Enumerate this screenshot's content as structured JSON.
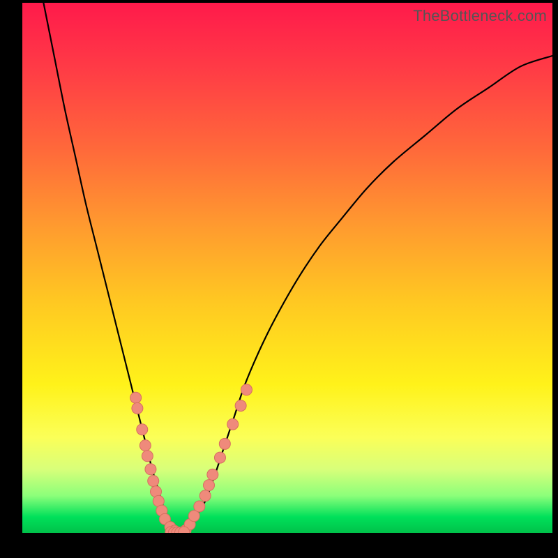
{
  "watermark": "TheBottleneck.com",
  "colors": {
    "curve": "#000000",
    "marker_fill": "#ef8a7b",
    "marker_stroke": "#d66e60",
    "background_top": "#ff1a4b",
    "background_bottom": "#00c24a"
  },
  "chart_data": {
    "type": "line",
    "title": "",
    "xlabel": "",
    "ylabel": "",
    "xlim": [
      0,
      100
    ],
    "ylim": [
      0,
      100
    ],
    "grid": false,
    "series": [
      {
        "name": "bottleneck_curve",
        "x": [
          4,
          6,
          8,
          10,
          12,
          14,
          16,
          18,
          20,
          21.5,
          23,
          24.5,
          26,
          27,
          28,
          29,
          30,
          31,
          34,
          36,
          38,
          40,
          42,
          45,
          48,
          52,
          56,
          60,
          65,
          70,
          76,
          82,
          88,
          94,
          100
        ],
        "y": [
          100,
          90,
          80,
          71,
          62,
          54,
          46,
          38,
          30,
          24,
          18,
          12,
          7,
          3.5,
          1.2,
          0.2,
          0.2,
          1.2,
          5,
          10,
          16,
          22,
          28,
          35,
          41,
          48,
          54,
          59,
          65,
          70,
          75,
          80,
          84,
          88,
          90
        ]
      }
    ],
    "markers": [
      {
        "name": "left_band_points",
        "x": [
          21.4,
          21.7,
          22.6,
          23.2,
          23.6,
          24.2,
          24.7,
          25.2,
          25.7,
          26.3,
          26.9,
          27.9,
          28.7
        ],
        "y": [
          25.5,
          23.5,
          19.5,
          16.5,
          14.5,
          12.0,
          9.8,
          7.8,
          6.0,
          4.2,
          2.6,
          1.1,
          0.4
        ]
      },
      {
        "name": "right_band_points",
        "x": [
          30.8,
          31.6,
          32.4,
          33.4,
          34.5,
          35.2,
          35.9,
          37.3,
          38.2,
          39.7,
          41.2,
          42.3
        ],
        "y": [
          0.5,
          1.6,
          3.2,
          5.0,
          7.0,
          9.0,
          11.0,
          14.2,
          16.8,
          20.5,
          24.0,
          27.0
        ]
      },
      {
        "name": "minimum_cluster",
        "x": [
          28.0,
          28.6,
          29.2,
          29.8,
          30.5
        ],
        "y": [
          0.15,
          0.05,
          0.05,
          0.05,
          0.15
        ]
      }
    ],
    "marker_radius_px": 8
  }
}
